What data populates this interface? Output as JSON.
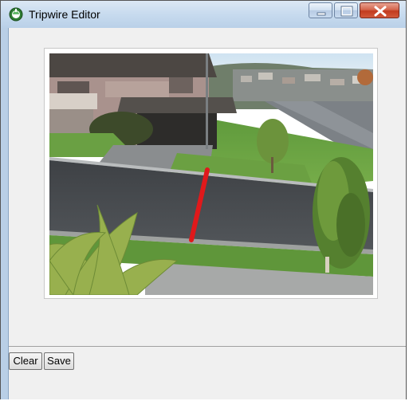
{
  "window": {
    "title": "Tripwire Editor"
  },
  "toolbar": {
    "clear_label": "Clear",
    "save_label": "Save"
  },
  "title_controls": {
    "minimize": "minimize",
    "maximize": "maximize",
    "close": "close"
  },
  "icons": {
    "app": "tripwire-app-icon",
    "minimize": "minimize-icon",
    "maximize": "maximize-icon",
    "close": "close-icon"
  },
  "colors": {
    "tripwire_line": "#e0191b",
    "close_button": "#c23b1f"
  }
}
